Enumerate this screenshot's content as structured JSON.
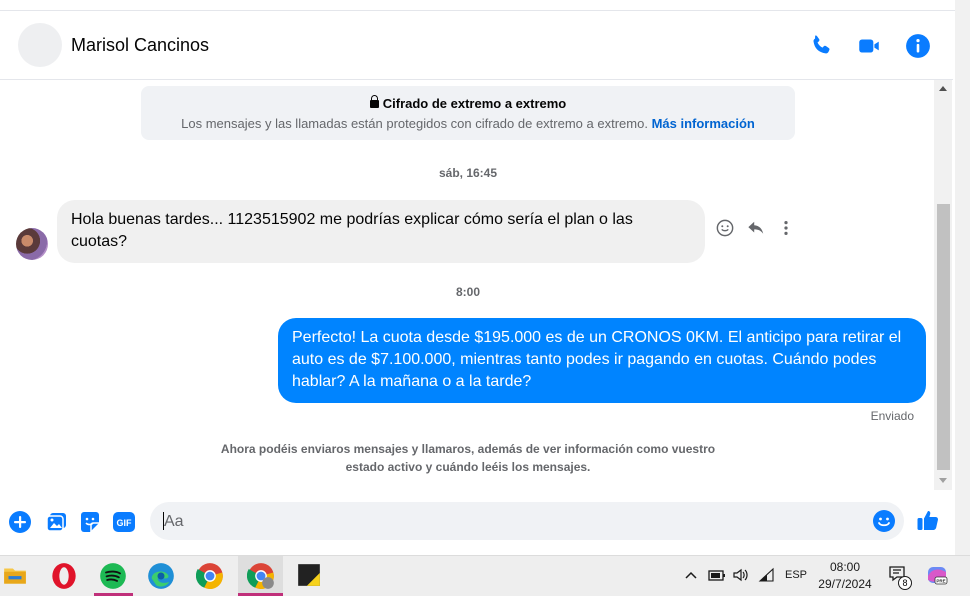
{
  "header": {
    "contact_name": "Marisol Cancinos"
  },
  "encryption_notice": {
    "title": "Cifrado de extremo a extremo",
    "text": "Los mensajes y las llamadas están protegidos con cifrado de extremo a extremo.",
    "link": "Más información"
  },
  "conversation": {
    "timestamp_1": "sáb, 16:45",
    "incoming_message": "Hola buenas tardes... 1123515902 me podrías explicar cómo sería el plan o las cuotas?",
    "timestamp_2": "8:00",
    "outgoing_message": "Perfecto! La cuota desde $195.000 es de un CRONOS 0KM. El anticipo para retirar el auto es de $7.100.000, mientras tanto podes ir pagando en cuotas. Cuándo podes hablar? A la mañana o a la tarde?",
    "sent_status": "Enviado",
    "info_note": "Ahora podéis enviaros mensajes y llamaros, además de ver información como vuestro estado activo y cuándo leéis los mensajes."
  },
  "composer": {
    "placeholder": "Aa"
  },
  "taskbar": {
    "language": "ESP",
    "time": "08:00",
    "date": "29/7/2024",
    "notification_count": "8"
  },
  "colors": {
    "accent": "#0084ff",
    "icon_blue": "#0a7cff",
    "incoming_bubble": "#f0f0f0"
  }
}
